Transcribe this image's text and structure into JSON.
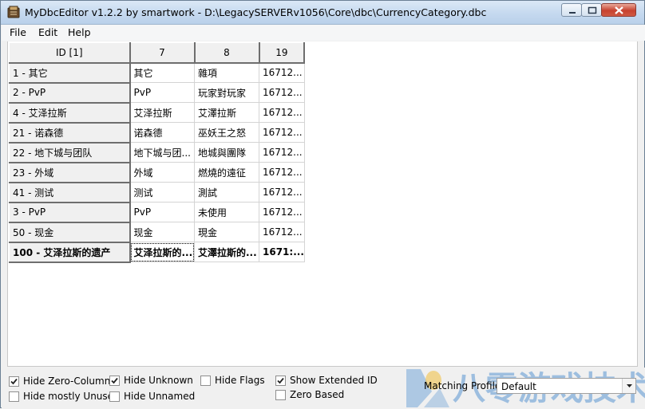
{
  "window": {
    "title": "MyDbcEditor v1.2.2 by smartwork - D:\\LegacySERVERv1056\\Core\\dbc\\CurrencyCategory.dbc"
  },
  "menu": [
    "File",
    "Edit",
    "Help"
  ],
  "grid": {
    "columns": [
      "ID [1]",
      "7",
      "8",
      "19"
    ],
    "rows": [
      {
        "id": "1 - 其它",
        "c7": "其它",
        "c8": "雜項",
        "c19": "16712..."
      },
      {
        "id": "2 - PvP",
        "c7": "PvP",
        "c8": "玩家對玩家",
        "c19": "16712..."
      },
      {
        "id": "4 - 艾泽拉斯",
        "c7": "艾泽拉斯",
        "c8": "艾澤拉斯",
        "c19": "16712..."
      },
      {
        "id": "21 - 诺森德",
        "c7": "诺森德",
        "c8": "巫妖王之怒",
        "c19": "16712..."
      },
      {
        "id": "22 - 地下城与团队",
        "c7": "地下城与团...",
        "c8": "地城與團隊",
        "c19": "16712..."
      },
      {
        "id": "23 - 外域",
        "c7": "外域",
        "c8": "燃燒的遠征",
        "c19": "16712..."
      },
      {
        "id": "41 - 测试",
        "c7": "测试",
        "c8": "測試",
        "c19": "16712..."
      },
      {
        "id": "3 - PvP",
        "c7": "PvP",
        "c8": "未使用",
        "c19": "16712..."
      },
      {
        "id": "50 - 现金",
        "c7": "现金",
        "c8": "現金",
        "c19": "16712..."
      },
      {
        "id": "100 - 艾泽拉斯的遗产",
        "c7": "艾泽拉斯的...",
        "c8": "艾澤拉斯的...",
        "c19": "1671:..."
      }
    ]
  },
  "options": {
    "hide_zero_columns": {
      "label": "Hide Zero-Columns",
      "checked": true
    },
    "hide_mostly_unused": {
      "label": "Hide mostly Unused",
      "checked": false
    },
    "hide_unknown": {
      "label": "Hide Unknown",
      "checked": true
    },
    "hide_unnamed": {
      "label": "Hide Unnamed",
      "checked": false
    },
    "hide_flags": {
      "label": "Hide Flags",
      "checked": false
    },
    "show_extended_id": {
      "label": "Show Extended ID",
      "checked": true
    },
    "zero_based": {
      "label": "Zero Based",
      "checked": false
    }
  },
  "profiles": {
    "label": "Matching Profiles:",
    "value": "Default"
  },
  "watermark": {
    "text": "八零游戏技术"
  },
  "colors": {
    "titlebar": "#c5d9ef",
    "close_button": "#c7422f",
    "watermark": "#5a96d2"
  }
}
